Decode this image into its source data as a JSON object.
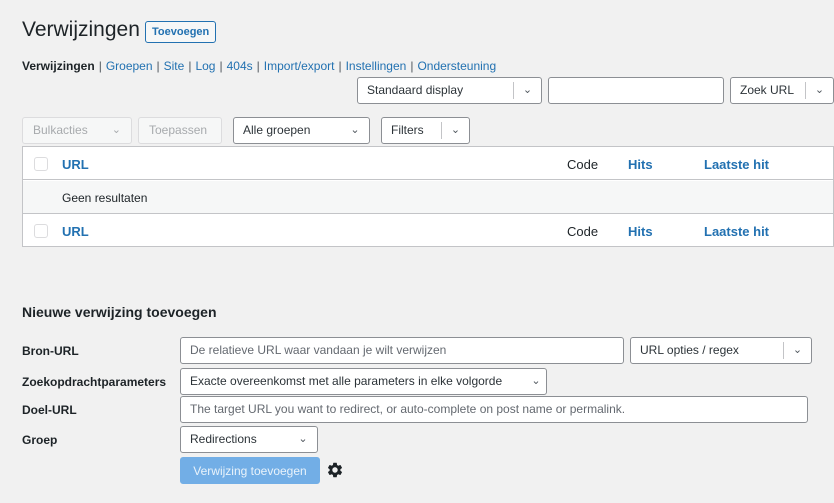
{
  "header": {
    "title": "Verwijzingen",
    "add_new": "Toevoegen"
  },
  "subnav": {
    "items": [
      "Verwijzingen",
      "Groepen",
      "Site",
      "Log",
      "404s",
      "Import/export",
      "Instellingen",
      "Ondersteuning"
    ],
    "separator": "|"
  },
  "top_controls": {
    "display_select": "Standaard display",
    "search_value": "",
    "search_select": "Zoek URL"
  },
  "filter_bar": {
    "bulk_actions": "Bulkacties",
    "apply": "Toepassen",
    "group_select": "Alle groepen",
    "filters": "Filters"
  },
  "table": {
    "columns": {
      "url": "URL",
      "code": "Code",
      "hits": "Hits",
      "last_hit": "Laatste hit"
    },
    "empty_message": "Geen resultaten"
  },
  "new_redirect": {
    "title": "Nieuwe verwijzing toevoegen",
    "source_label": "Bron-URL",
    "source_placeholder": "De relatieve URL waar vandaan je wilt verwijzen",
    "source_options": "URL opties / regex",
    "query_label": "Zoekopdrachtparameters",
    "query_value": "Exacte overeenkomst met alle parameters in elke volgorde",
    "target_label": "Doel-URL",
    "target_placeholder": "The target URL you want to redirect, or auto-complete on post name or permalink.",
    "group_label": "Groep",
    "group_value": "Redirections",
    "submit": "Verwijzing toevoegen",
    "settings_icon": "gear-icon"
  },
  "colors": {
    "link": "#2271b1",
    "primary_disabled": "#72aee6",
    "background": "#f1f1f1"
  }
}
